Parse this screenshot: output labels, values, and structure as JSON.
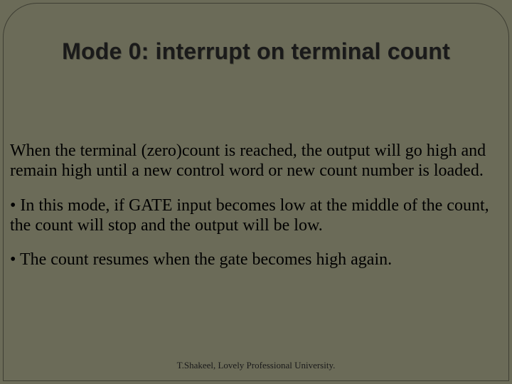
{
  "title": "Mode 0: interrupt on terminal count",
  "paragraphs": {
    "p1": "When the terminal (zero)count is reached, the output will go high and remain high until a new control word or new count number is loaded.",
    "p2": "• In this mode, if GATE input becomes low at the middle of the count, the count will stop and the output will be low.",
    "p3": "• The count resumes when the gate becomes high again."
  },
  "footer": "T.Shakeel, Lovely Professional University."
}
